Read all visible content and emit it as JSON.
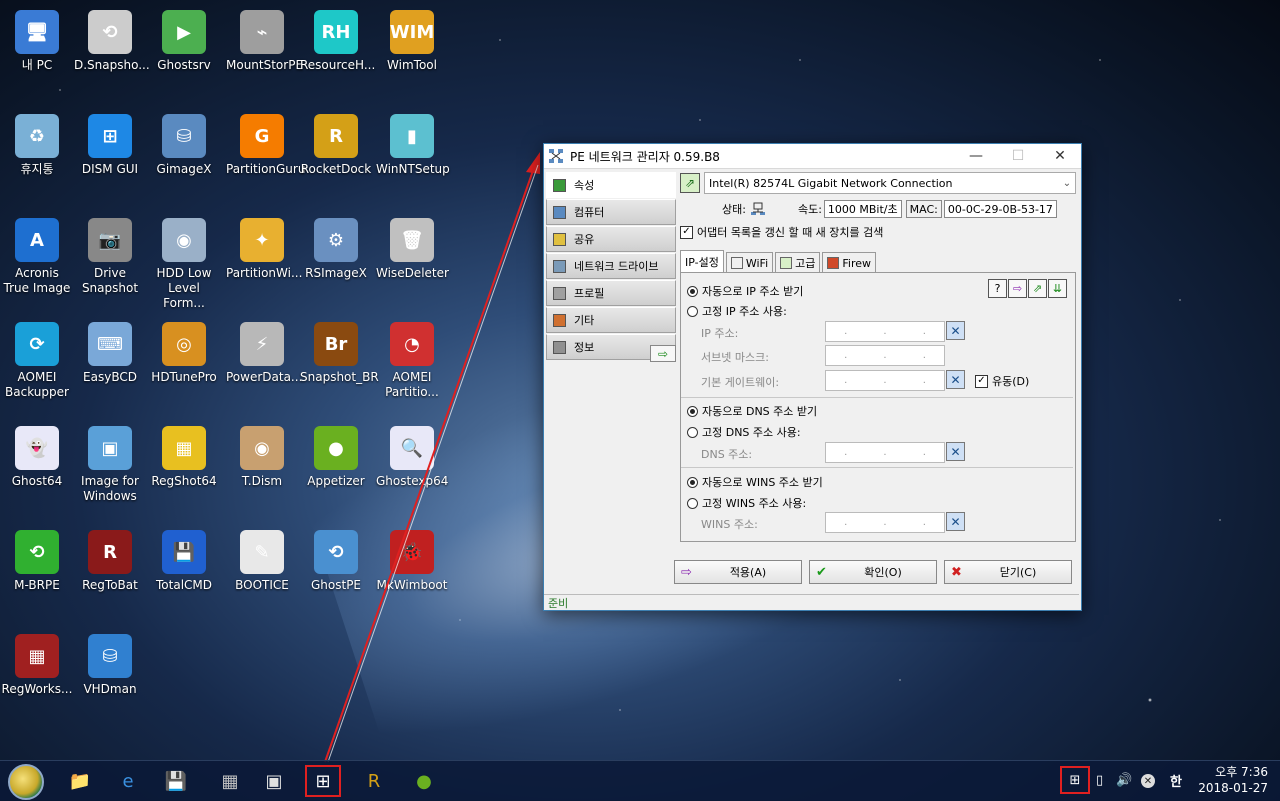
{
  "desktop": {
    "icons": [
      {
        "label": "내 PC",
        "color": "#3a7bd5",
        "glyph": "🖥"
      },
      {
        "label": "D.Snapsho...",
        "color": "#cccccc",
        "glyph": "⟲"
      },
      {
        "label": "Ghostsrv",
        "color": "#4caf50",
        "glyph": "▶"
      },
      {
        "label": "MountStorPE",
        "color": "#9e9e9e",
        "glyph": "⌁"
      },
      {
        "label": "ResourceH...",
        "color": "#1ec8c8",
        "glyph": "RH"
      },
      {
        "label": "WimTool",
        "color": "#e0a020",
        "glyph": "WIM"
      },
      {
        "label": "휴지통",
        "color": "#7ab0d6",
        "glyph": "♻"
      },
      {
        "label": "DISM GUI",
        "color": "#1e88e5",
        "glyph": "⊞"
      },
      {
        "label": "GimageX",
        "color": "#5a8ac0",
        "glyph": "⛁"
      },
      {
        "label": "PartitionGuru",
        "color": "#f57c00",
        "glyph": "G"
      },
      {
        "label": "RocketDock",
        "color": "#d4a017",
        "glyph": "R"
      },
      {
        "label": "WinNTSetup",
        "color": "#5cc0d0",
        "glyph": "▮"
      },
      {
        "label": "Acronis True Image",
        "color": "#1e6fd0",
        "glyph": "A"
      },
      {
        "label": "Drive Snapshot",
        "color": "#888888",
        "glyph": "📷"
      },
      {
        "label": "HDD Low Level Form...",
        "color": "#9ab0c8",
        "glyph": "◉"
      },
      {
        "label": "PartitionWi...",
        "color": "#e8b030",
        "glyph": "✦"
      },
      {
        "label": "RSImageX",
        "color": "#6a90c0",
        "glyph": "⚙"
      },
      {
        "label": "WiseDeleter",
        "color": "#c0c0c0",
        "glyph": "🗑"
      },
      {
        "label": "AOMEI Backupper",
        "color": "#1aa0d8",
        "glyph": "⟳"
      },
      {
        "label": "EasyBCD",
        "color": "#7aa8d8",
        "glyph": "⌨"
      },
      {
        "label": "HDTunePro",
        "color": "#d89020",
        "glyph": "◎"
      },
      {
        "label": "PowerData...",
        "color": "#b8b8b8",
        "glyph": "⚡"
      },
      {
        "label": "Snapshot_BR",
        "color": "#8a4a10",
        "glyph": "Br"
      },
      {
        "label": "AOMEI Partitio...",
        "color": "#d03030",
        "glyph": "◔"
      },
      {
        "label": "Ghost64",
        "color": "#e8e8f8",
        "glyph": "👻"
      },
      {
        "label": "Image for Windows",
        "color": "#5aa0d8",
        "glyph": "▣"
      },
      {
        "label": "RegShot64",
        "color": "#e8c020",
        "glyph": "▦"
      },
      {
        "label": "T.Dism",
        "color": "#c8a070",
        "glyph": "◉"
      },
      {
        "label": "Appetizer",
        "color": "#6ab020",
        "glyph": "●"
      },
      {
        "label": "Ghostexp64",
        "color": "#e8e8f8",
        "glyph": "🔍"
      },
      {
        "label": "M-BRPE",
        "color": "#30b030",
        "glyph": "⟲"
      },
      {
        "label": "RegToBat",
        "color": "#8a1a1a",
        "glyph": "R"
      },
      {
        "label": "TotalCMD",
        "color": "#2060d0",
        "glyph": "💾"
      },
      {
        "label": "BOOTICE",
        "color": "#e8e8e8",
        "glyph": "✎"
      },
      {
        "label": "GhostPE",
        "color": "#4a90d0",
        "glyph": "⟲"
      },
      {
        "label": "MkWimboot",
        "color": "#c02020",
        "glyph": "🐞"
      },
      {
        "label": "RegWorks...",
        "color": "#a02020",
        "glyph": "▦"
      },
      {
        "label": "VHDman",
        "color": "#3080d0",
        "glyph": "⛁"
      }
    ]
  },
  "window": {
    "title": "PE 네트워크 관리자 0.59.B8",
    "minimize": "—",
    "maximize": "☐",
    "close": "✕",
    "sidebar": [
      {
        "label": "속성",
        "color": "#3a9a3a"
      },
      {
        "label": "컴퓨터",
        "color": "#5a8ac0"
      },
      {
        "label": "공유",
        "color": "#e0c040"
      },
      {
        "label": "네트워크 드라이브",
        "color": "#7a9ab8"
      },
      {
        "label": "프로필",
        "color": "#a0a0a0"
      },
      {
        "label": "기타",
        "color": "#d07030"
      },
      {
        "label": "정보",
        "color": "#909090"
      }
    ],
    "sidebar_go": "⇨",
    "adapter": "Intel(R) 82574L Gigabit Network Connection",
    "status_label": "상태:",
    "speed_label": "속도:",
    "speed_value": "1000 MBit/초",
    "mac_label": "MAC:",
    "mac_value": "00-0C-29-0B-53-17",
    "rescan_label": "어댑터 목록을 갱신 할 때 새 장치를 검색",
    "rescan_checked": "✓",
    "tabs": [
      "IP-설정",
      "WiFi",
      "고급",
      "Firew"
    ],
    "ip": {
      "auto_ip": "자동으로 IP 주소 받기",
      "static_ip": "고정 IP 주소 사용:",
      "ip_label": "IP 주소:",
      "mask_label": "서브넷 마스크:",
      "gateway_label": "기본 게이트웨이:",
      "dots": ".",
      "metric_label": "유동(D)",
      "metric_checked": "✓",
      "auto_dns": "자동으로 DNS 주소 받기",
      "static_dns": "고정 DNS 주소 사용:",
      "dns_label": "DNS 주소:",
      "auto_wins": "자동으로 WINS 주소 받기",
      "static_wins": "고정 WINS 주소 사용:",
      "wins_label": "WINS 주소:",
      "clear": "✕"
    },
    "tool_buttons": [
      "?",
      "⇨",
      "⇗",
      "⇊"
    ],
    "buttons": {
      "apply": "적용(A)",
      "ok": "확인(O)",
      "close": "닫기(C)",
      "apply_icon": "⇨",
      "ok_icon": "✔",
      "close_icon": "✖"
    },
    "statusbar": "준비"
  },
  "taskbar": {
    "apps": [
      {
        "name": "file-explorer",
        "glyph": "📁"
      },
      {
        "name": "internet-explorer",
        "glyph": "e"
      },
      {
        "name": "save",
        "glyph": "💾"
      },
      {
        "name": "ghost",
        "glyph": "▦"
      },
      {
        "name": "display",
        "glyph": "▣"
      },
      {
        "name": "network-manager",
        "glyph": "⊞"
      },
      {
        "name": "rocketdock",
        "glyph": "R"
      },
      {
        "name": "appetizer",
        "glyph": "●"
      }
    ],
    "tray": {
      "volume": "🔊",
      "ime": "한"
    },
    "clock_time": "오후 7:36",
    "clock_date": "2018-01-27"
  },
  "colors": {
    "accent": "#3c7fb1",
    "annotation": "#e02020"
  }
}
